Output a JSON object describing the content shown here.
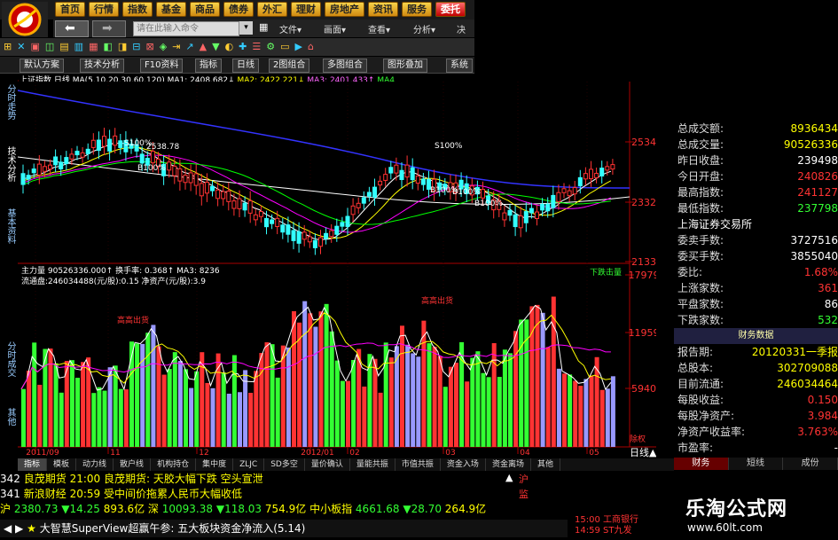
{
  "top_menu": [
    "首页",
    "行情",
    "指数",
    "基金",
    "商品",
    "债券",
    "外汇",
    "理财",
    "房地产",
    "资讯",
    "服务",
    "委托"
  ],
  "active_menu": "委托",
  "command_placeholder": "请在此输入命令",
  "toolbar2_menus": [
    "文件▾",
    "画面▾",
    "查看▾",
    "分析▾",
    "决"
  ],
  "toolbar4": [
    "默认方案",
    "技术分析",
    "F10资料",
    "指标",
    "日线",
    "2图组合",
    "多图组合",
    "图形叠加",
    "系统"
  ],
  "ma_bar": {
    "title": "上证指数 日线",
    "ma": "MA(5,10,20,30,60,120)",
    "ma1": "MA1: 2408.682↓",
    "ma2": "MA2: 2422.221↓",
    "ma3": "MA3: 2401.433↑",
    "ma4": "MA4"
  },
  "left_tabs": [
    "分时走势",
    "技术分析",
    "基本资料",
    "分时成交",
    "其他"
  ],
  "chart": {
    "price_axis": [
      "2534",
      "2332",
      "2133"
    ],
    "volume_axis": [
      "17979",
      "11959",
      "5940"
    ],
    "x_axis": [
      "2011/09",
      "11",
      "12",
      "2012/01",
      "02",
      "03",
      "04",
      "05"
    ],
    "annotations": [
      "S100%",
      "B100%",
      "B100%",
      "B100%",
      "B100%",
      "S100%",
      "2538.78",
      "下跌击量",
      "高高出货",
      "高高出货"
    ],
    "vol_info1": "主力量 90526336.000↑ 换手率: 0.368↑ MA3: 8236",
    "vol_info2": "流通盘:246034488(元/股):0.15 净资产(元/股):3.9",
    "cq_label": "除权",
    "dayline_label": "日线▲"
  },
  "chart_data": {
    "type": "candlestick",
    "x": [
      "2011/09",
      "11",
      "12",
      "2012/01",
      "02",
      "03",
      "04",
      "05"
    ],
    "ylim": [
      2133,
      2534
    ]
  },
  "quote_panel": {
    "rows": [
      {
        "k": "总成交额:",
        "v": "8936434",
        "c": "yel"
      },
      {
        "k": "总成交量:",
        "v": "90526336",
        "c": "yel"
      },
      {
        "k": "昨日收盘:",
        "v": "239498",
        "c": "wht"
      },
      {
        "k": "今日开盘:",
        "v": "240826",
        "c": "red"
      },
      {
        "k": "最高指数:",
        "v": "241127",
        "c": "red"
      },
      {
        "k": "最低指数:",
        "v": "237798",
        "c": "grn"
      }
    ],
    "exchange": "上海证券交易所",
    "rows2": [
      {
        "k": "委卖手数:",
        "v": "3727516",
        "c": "wht"
      },
      {
        "k": "委买手数:",
        "v": "3855040",
        "c": "wht"
      },
      {
        "k": "委比:",
        "v": "1.68%",
        "c": "red"
      },
      {
        "k": "上涨家数:",
        "v": "361",
        "c": "red"
      },
      {
        "k": "平盘家数:",
        "v": "86",
        "c": "wht"
      },
      {
        "k": "下跌家数:",
        "v": "532",
        "c": "grn"
      }
    ],
    "fin_header": "财务数据",
    "rows3": [
      {
        "k": "报告期:",
        "v": "20120331一季报",
        "c": "yel"
      },
      {
        "k": "总股本:",
        "v": "302709088",
        "c": "yel"
      },
      {
        "k": "目前流通:",
        "v": "246034464",
        "c": "yel"
      },
      {
        "k": "每股收益:",
        "v": "0.150",
        "c": "red"
      },
      {
        "k": "每股净资产:",
        "v": "3.984",
        "c": "red"
      },
      {
        "k": "净资产收益率:",
        "v": "3.763%",
        "c": "red"
      },
      {
        "k": "市盈率:",
        "v": "-",
        "c": "wht"
      }
    ],
    "bottom_tabs": [
      "财务",
      "短线",
      "成份"
    ]
  },
  "bottom_tabs": [
    "指标",
    "模板",
    "动力线",
    "散户线",
    "机构持仓",
    "集中度",
    "ZLJC",
    "SD多空",
    "量价确认",
    "量能共振",
    "市值共振",
    "资金入场",
    "资金离场",
    "其他"
  ],
  "news": [
    {
      "id": "342",
      "src": "良茂期货",
      "text": "21:00 良茂期货: 天胶大幅下跌 空头宣泄"
    },
    {
      "id": "341",
      "src": "新浪财经",
      "text": "20:59 受中间价拖累人民币大幅收低"
    }
  ],
  "ticker": {
    "sh_label": "沪",
    "sh": "2380.73",
    "sh_chg": "▼14.25",
    "sh_amt": "893.6亿",
    "sz_label": "深",
    "sz": "10093.38",
    "sz_chg": "▼118.03",
    "sz_amt": "754.9亿",
    "zx_label": "中小板指",
    "zx": "4661.68",
    "zx_chg": "▼28.70",
    "zx_amt": "264.9亿"
  },
  "status_text": "大智慧SuperView超赢午参: 五大板块资金净流入(5.14)",
  "alerts": [
    "15:00 工商银行",
    "14:59 ST九发"
  ],
  "side_markers": [
    "沪",
    "监"
  ],
  "watermark": {
    "title": "乐淘公式网",
    "url": "www.60lt.com"
  }
}
